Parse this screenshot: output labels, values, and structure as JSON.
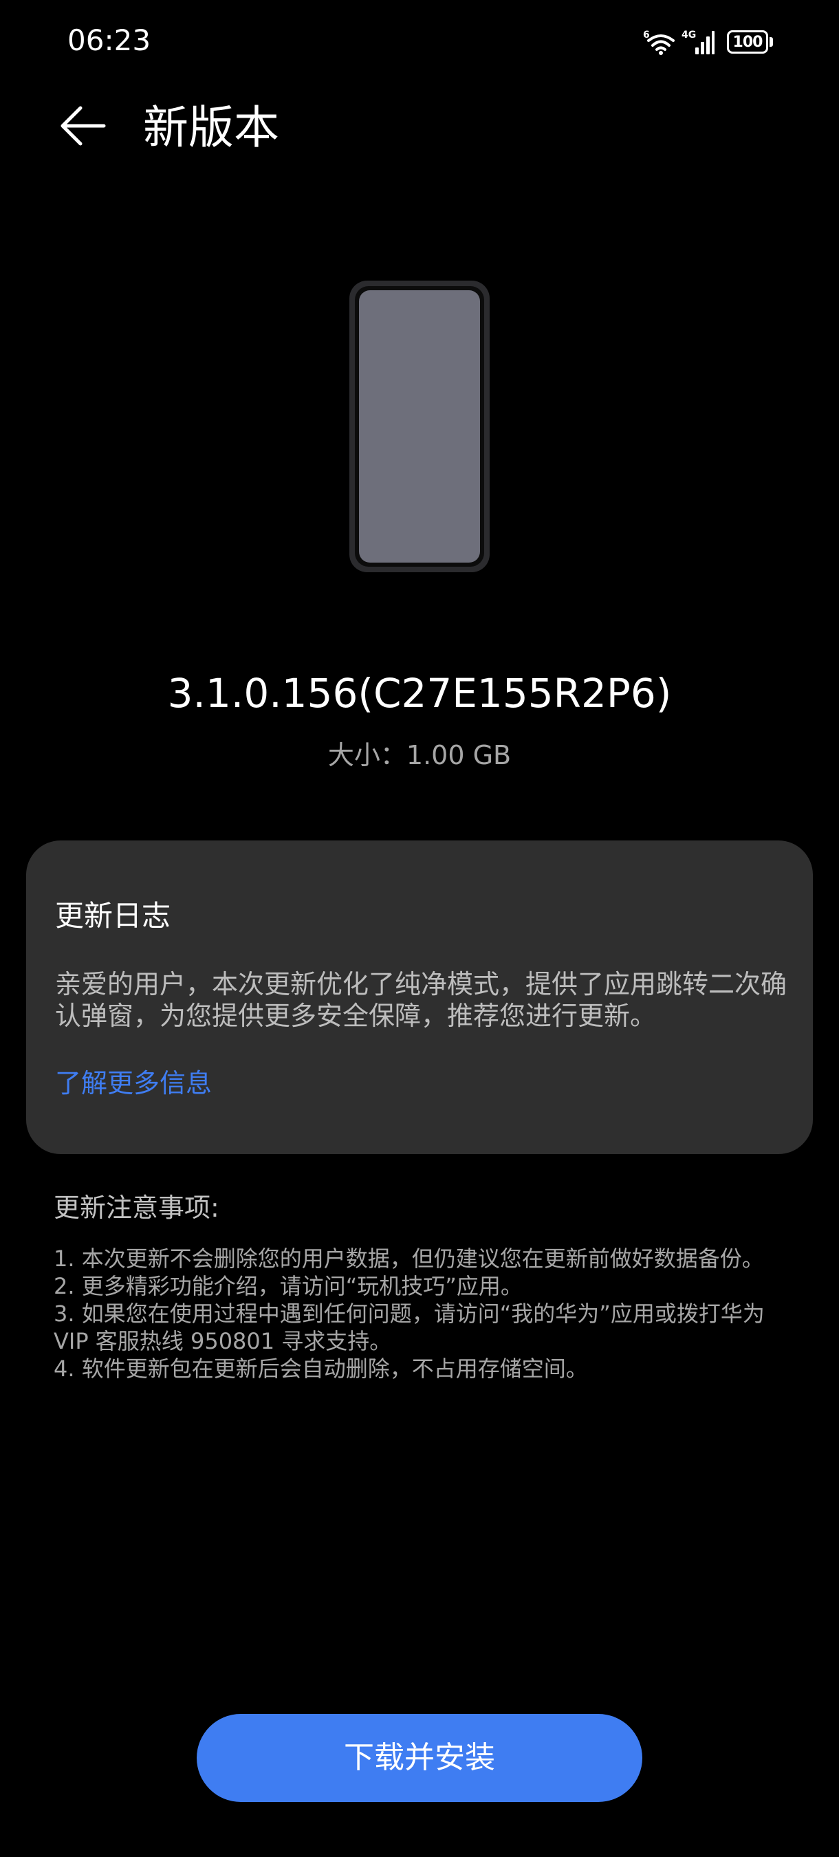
{
  "status_bar": {
    "time": "06:23",
    "wifi_badge": "6",
    "network_type": "4G",
    "battery_level": "100",
    "icons": [
      "wifi-icon",
      "signal-icon",
      "battery-icon"
    ]
  },
  "header": {
    "back_icon": "arrow-left-icon",
    "title": "新版本"
  },
  "update": {
    "illustration_icon": "phone-icon",
    "version": "3.1.0.156(C27E155R2P6)",
    "size_text": "大小：1.00 GB"
  },
  "changelog": {
    "title": "更新日志",
    "body": "亲爱的用户，本次更新优化了纯净模式，提供了应用跳转二次确认弹窗，为您提供更多安全保障，推荐您进行更新。",
    "link_label": "了解更多信息"
  },
  "notes": {
    "title": "更新注意事项:",
    "items": [
      "1. 本次更新不会删除您的用户数据，但仍建议您在更新前做好数据备份。",
      "2. 更多精彩功能介绍，请访问“玩机技巧”应用。",
      "3. 如果您在使用过程中遇到任何问题，请访问“我的华为”应用或拨打华为VIP 客服热线 950801 寻求支持。",
      "4. 软件更新包在更新后会自动删除，不占用存储空间。"
    ]
  },
  "actions": {
    "download_label": "下载并安装"
  },
  "colors": {
    "background": "#000000",
    "card": "#2f2f2f",
    "accent": "#3f7df2",
    "secondary_text": "#a6a6a6"
  }
}
